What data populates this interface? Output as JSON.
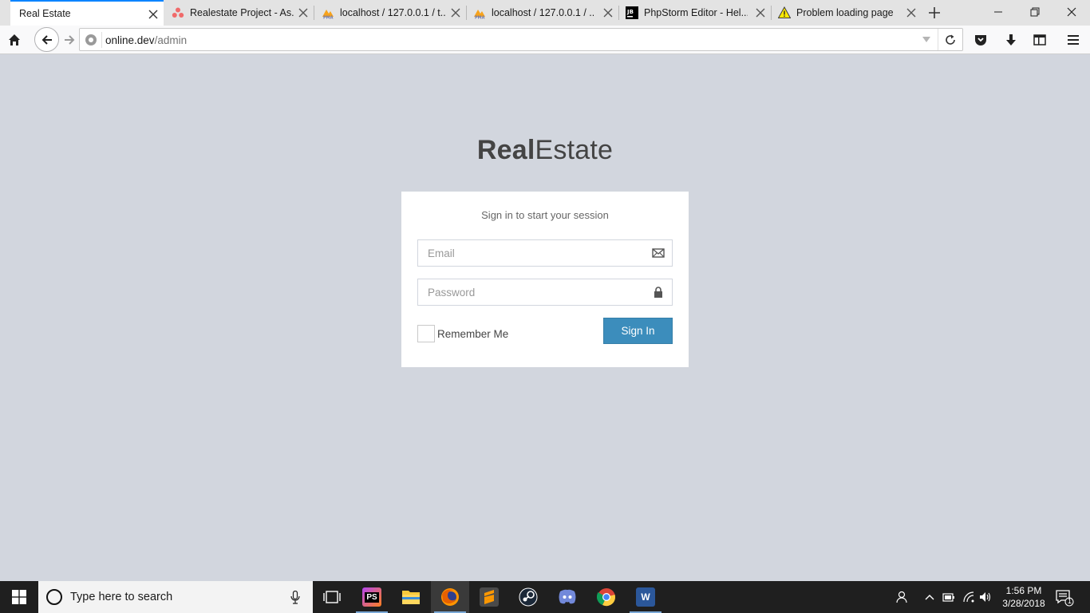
{
  "browser": {
    "tabs": [
      {
        "title": "Real Estate",
        "active": true,
        "icon": "none"
      },
      {
        "title": "Realestate Project - As...",
        "active": false,
        "icon": "asana-icon"
      },
      {
        "title": "localhost / 127.0.0.1 / t...",
        "active": false,
        "icon": "phpmyadmin-icon"
      },
      {
        "title": "localhost / 127.0.0.1 / ...",
        "active": false,
        "icon": "phpmyadmin-icon"
      },
      {
        "title": "PhpStorm Editor - Hel...",
        "active": false,
        "icon": "jetbrains-icon"
      },
      {
        "title": "Problem loading page",
        "active": false,
        "icon": "warning-icon"
      }
    ],
    "url": {
      "host": "online.dev",
      "path": "/admin"
    }
  },
  "page": {
    "logo_bold": "Real",
    "logo_light": "Estate",
    "login_message": "Sign in to start your session",
    "email_placeholder": "Email",
    "password_placeholder": "Password",
    "remember_label": "Remember Me",
    "signin_label": "Sign In",
    "accent_color": "#3c8dbc"
  },
  "taskbar": {
    "search_placeholder": "Type here to search",
    "apps": [
      "task-view-icon",
      "phpstorm-icon",
      "file-explorer-icon",
      "firefox-icon",
      "sublime-text-icon",
      "steam-icon",
      "discord-icon",
      "chrome-icon",
      "word-icon"
    ],
    "time": "1:56 PM",
    "date": "3/28/2018",
    "notification_count": "1"
  }
}
